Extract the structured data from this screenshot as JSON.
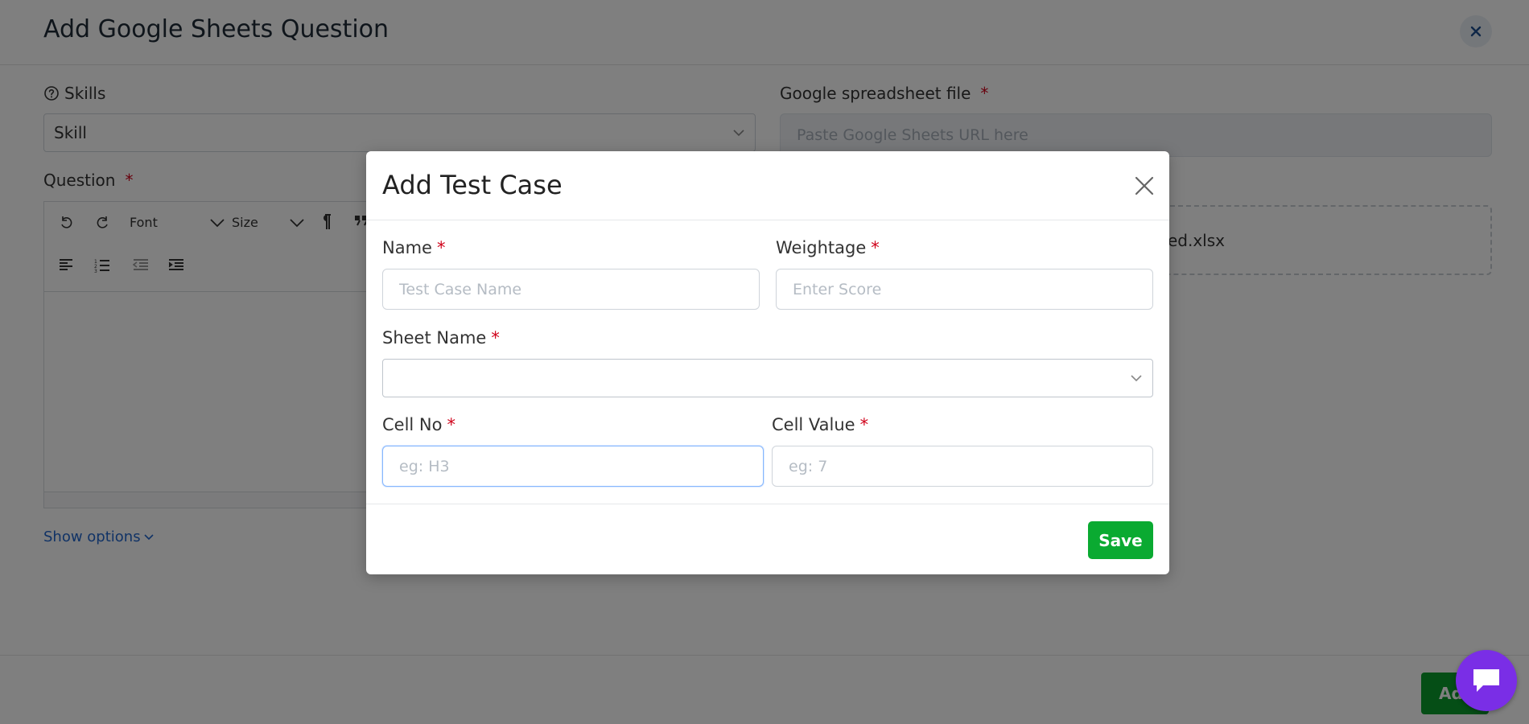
{
  "background": {
    "title": "Add Google Sheets Question",
    "skills_label": "Skills",
    "skill_select_value": "Skill",
    "question_label": "Question",
    "required_mark": "*",
    "spreadsheet_label": "Google spreadsheet file",
    "spreadsheet_placeholder": "Paste Google Sheets URL here",
    "file_name_fragment": "xed.xlsx",
    "toolbar": {
      "font_label": "Font",
      "size_label": "Size"
    },
    "show_options_label": "Show options",
    "add_button_label": "Ad"
  },
  "modal": {
    "title": "Add Test Case",
    "name_label": "Name",
    "name_placeholder": "Test Case Name",
    "name_value": "",
    "weightage_label": "Weightage",
    "weightage_placeholder": "Enter Score",
    "weightage_value": "",
    "sheet_name_label": "Sheet Name",
    "sheet_name_value": "",
    "cell_no_label": "Cell No",
    "cell_no_placeholder": "eg: H3",
    "cell_no_value": "",
    "cell_value_label": "Cell Value",
    "cell_value_placeholder": "eg: 7",
    "cell_value_value": "",
    "required_mark": "*",
    "save_label": "Save"
  },
  "colors": {
    "save_green": "#0aaa31",
    "required_red": "#d0021b",
    "link_blue": "#2266cc",
    "chat_purple": "#7a2ee6"
  }
}
